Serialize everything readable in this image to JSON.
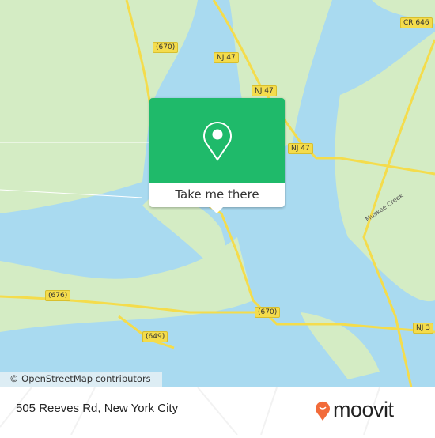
{
  "map": {
    "road_labels": [
      "NJ 47",
      "NJ 47",
      "NJ 47",
      "(670)",
      "(670)",
      "CR 646",
      "(676)",
      "(649)",
      "NJ 3"
    ],
    "water_label": "Muskee Creek",
    "attribution": "© OpenStreetMap contributors",
    "colors": {
      "water": "#a9daf0",
      "land": "#d4ecc4",
      "road": "#f4dc4c"
    }
  },
  "popup": {
    "button_label": "Take me there",
    "color": "#1fba6a",
    "icon": "map-pin-icon"
  },
  "footer": {
    "address": "505 Reeves Rd, New York City",
    "brand": "moovit",
    "brand_color": "#f26b3a"
  }
}
